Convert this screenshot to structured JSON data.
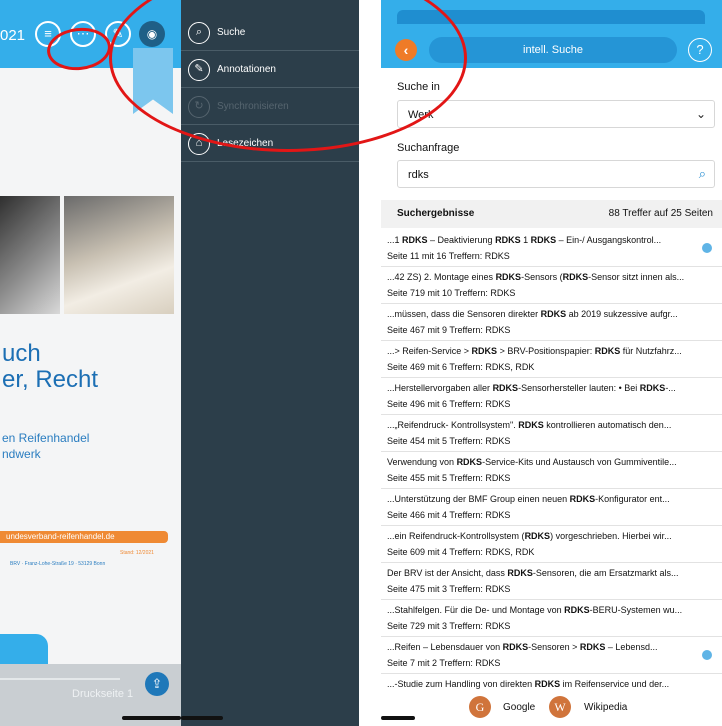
{
  "left_panel": {
    "year_fragment": "021",
    "cover_title_line1": "uch",
    "cover_title_line2": "er, Recht",
    "cover_sub_line1": "en Reifenhandel",
    "cover_sub_line2": "ndwerk",
    "banner_url": "undesverband-reifenhandel.de",
    "stand": "Stand: 12/2021",
    "address": "BRV · Franz-Lohe-Straße 19 · 53129 Bonn",
    "print_page": "Druckseite 1"
  },
  "menu": [
    {
      "label": "Suche",
      "icon": "search-icon",
      "glyph": "⌕",
      "enabled": true
    },
    {
      "label": "Annotationen",
      "icon": "paperclip-icon",
      "glyph": "✎",
      "enabled": true
    },
    {
      "label": "Synchronisieren",
      "icon": "sync-icon",
      "glyph": "↻",
      "enabled": false
    },
    {
      "label": "Lesezeichen",
      "icon": "bookmark-icon",
      "glyph": "⌂",
      "enabled": true
    }
  ],
  "search": {
    "header_title": "intell. Suche",
    "search_in_label": "Suche in",
    "search_in_value": "Werk",
    "query_label": "Suchanfrage",
    "query_value": "rdks",
    "results_label": "Suchergebnisse",
    "results_count": "88 Treffer auf 25 Seiten"
  },
  "results": [
    {
      "text": "...1 RDKS – Deaktivierung RDKS 1 RDKS – Ein-/ Ausgangskontrol...",
      "meta": "Seite 11 mit 16 Treffern: RDKS",
      "dot": true
    },
    {
      "text": "...42 ZS) 2. Montage eines RDKS-Sensors (RDKS-Sensor sitzt innen als...",
      "meta": "Seite 719 mit 10 Treffern: RDKS",
      "dot": false
    },
    {
      "text": "...müssen, dass die Sensoren direkter RDKS ab 2019 sukzessive aufgr...",
      "meta": "Seite 467 mit 9 Treffern: RDKS",
      "dot": false
    },
    {
      "text": "...> Reifen-Service > RDKS > BRV-Positionspapier: RDKS für Nutzfahrz...",
      "meta": "Seite 469 mit 6 Treffern: RDKS, RDK",
      "dot": false
    },
    {
      "text": "...Herstellervorgaben aller RDKS-Sensorhersteller lauten: • Bei RDKS-...",
      "meta": "Seite 496 mit 6 Treffern: RDKS",
      "dot": false
    },
    {
      "text": "...„Reifendruck- Kontrollsystem\". RDKS kontrollieren automatisch den...",
      "meta": "Seite 454 mit 5 Treffern: RDKS",
      "dot": false
    },
    {
      "text": "Verwendung von RDKS-Service-Kits und Austausch von Gummiventile...",
      "meta": "Seite 455 mit 5 Treffern: RDKS",
      "dot": false
    },
    {
      "text": "...Unterstützung der BMF Group einen neuen RDKS-Konfigurator ent...",
      "meta": "Seite 466 mit 4 Treffern: RDKS",
      "dot": false
    },
    {
      "text": "...ein Reifendruck-Kontrollsystem (RDKS) vorgeschrieben. Hierbei wir...",
      "meta": "Seite 609 mit 4 Treffern: RDKS, RDK",
      "dot": false
    },
    {
      "text": "Der BRV ist der Ansicht, dass RDKS-Sensoren, die am Ersatzmarkt als...",
      "meta": "Seite 475 mit 3 Treffern: RDKS",
      "dot": false
    },
    {
      "text": "...Stahlfelgen. Für die De- und Montage von RDKS-BERU-Systemen wu...",
      "meta": "Seite 729 mit 3 Treffern: RDKS",
      "dot": false
    },
    {
      "text": "...Reifen – Lebensdauer von RDKS-Sensoren > RDKS – Lebensd...",
      "meta": "Seite 7 mit 2 Treffern: RDKS",
      "dot": true
    },
    {
      "text": "...-Studie zum Handling von direkten RDKS im Reifenservice und der...",
      "meta": "",
      "dot": false
    }
  ],
  "footer": {
    "google_label": "Google",
    "google_glyph": "G",
    "wikipedia_label": "Wikipedia",
    "wikipedia_glyph": "W"
  },
  "colors": {
    "accent_blue": "#34aeea",
    "menu_bg": "#2c3e4a",
    "orange": "#ef7b27",
    "annotation_red": "#e21616"
  }
}
